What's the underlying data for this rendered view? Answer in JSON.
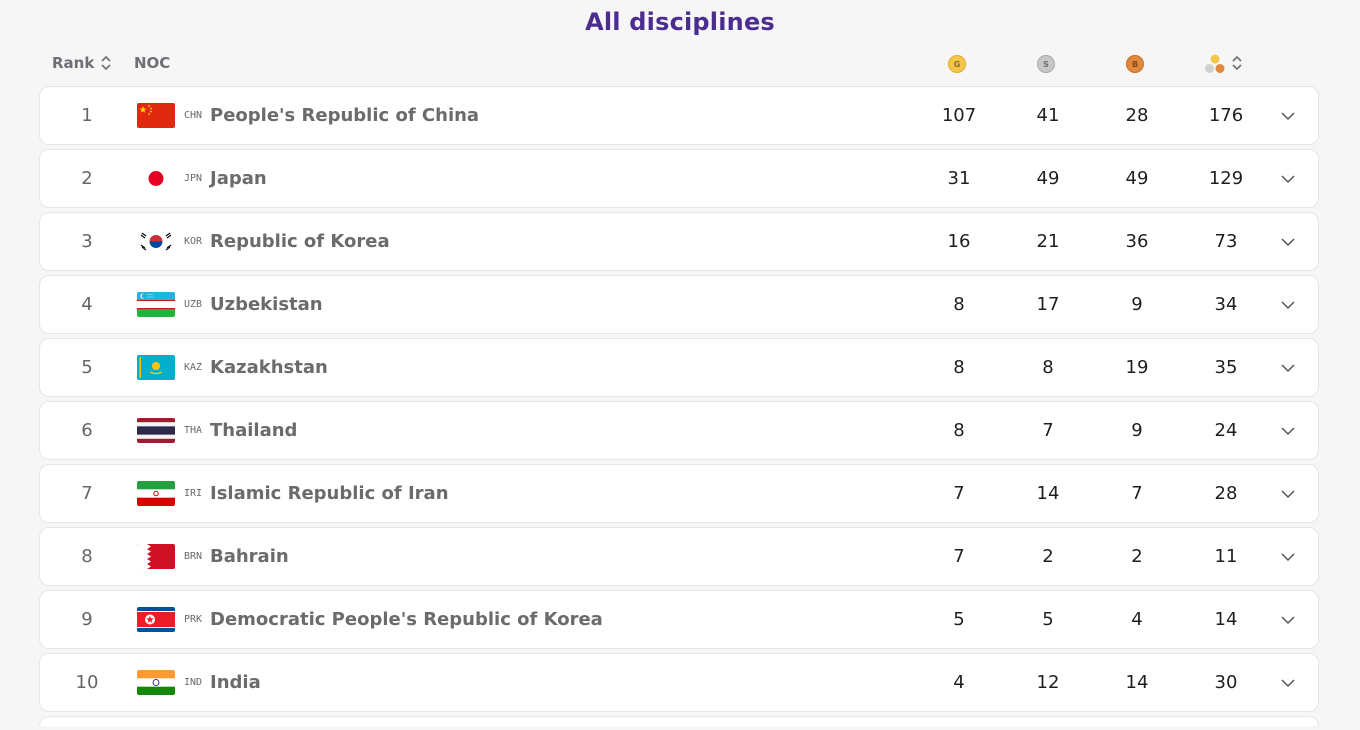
{
  "title": "All disciplines",
  "header": {
    "rank": "Rank",
    "noc": "NOC",
    "gold_letter": "G",
    "silver_letter": "S",
    "bronze_letter": "B",
    "gold_icon": "gold-medal-icon",
    "silver_icon": "silver-medal-icon",
    "bronze_icon": "bronze-medal-icon",
    "total_icon": "medals-total-icon"
  },
  "colors": {
    "title": "#4b2c8f",
    "gold": "#f3c64a",
    "silver": "#c7c7c7",
    "bronze": "#e0883b"
  },
  "rows": [
    {
      "rank": "1",
      "code": "CHN",
      "country": "People's Republic of China",
      "gold": "107",
      "silver": "41",
      "bronze": "28",
      "total": "176"
    },
    {
      "rank": "2",
      "code": "JPN",
      "country": "Japan",
      "gold": "31",
      "silver": "49",
      "bronze": "49",
      "total": "129"
    },
    {
      "rank": "3",
      "code": "KOR",
      "country": "Republic of Korea",
      "gold": "16",
      "silver": "21",
      "bronze": "36",
      "total": "73"
    },
    {
      "rank": "4",
      "code": "UZB",
      "country": "Uzbekistan",
      "gold": "8",
      "silver": "17",
      "bronze": "9",
      "total": "34"
    },
    {
      "rank": "5",
      "code": "KAZ",
      "country": "Kazakhstan",
      "gold": "8",
      "silver": "8",
      "bronze": "19",
      "total": "35"
    },
    {
      "rank": "6",
      "code": "THA",
      "country": "Thailand",
      "gold": "8",
      "silver": "7",
      "bronze": "9",
      "total": "24"
    },
    {
      "rank": "7",
      "code": "IRI",
      "country": "Islamic Republic of Iran",
      "gold": "7",
      "silver": "14",
      "bronze": "7",
      "total": "28"
    },
    {
      "rank": "8",
      "code": "BRN",
      "country": "Bahrain",
      "gold": "7",
      "silver": "2",
      "bronze": "2",
      "total": "11"
    },
    {
      "rank": "9",
      "code": "PRK",
      "country": "Democratic People's Republic of Korea",
      "gold": "5",
      "silver": "5",
      "bronze": "4",
      "total": "14"
    },
    {
      "rank": "10",
      "code": "IND",
      "country": "India",
      "gold": "4",
      "silver": "12",
      "bronze": "14",
      "total": "30"
    }
  ]
}
